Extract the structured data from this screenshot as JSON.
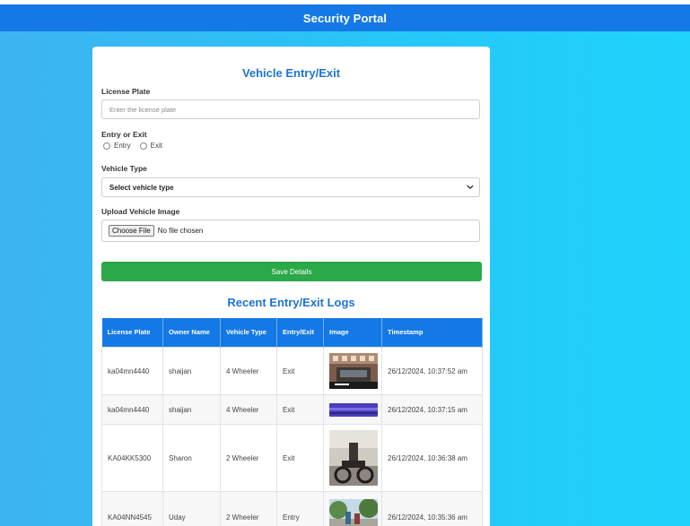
{
  "header": {
    "title": "Security Portal"
  },
  "form": {
    "title": "Vehicle Entry/Exit",
    "license_plate_label": "License Plate",
    "license_plate_placeholder": "Enter the license plate",
    "entry_exit_label": "Entry or Exit",
    "entry_option": "Entry",
    "exit_option": "Exit",
    "vehicle_type_label": "Vehicle Type",
    "vehicle_type_selected": "Select vehicle type",
    "upload_label": "Upload Vehicle Image",
    "choose_file_label": "Choose File",
    "file_status": "No file chosen",
    "save_label": "Save Details"
  },
  "logs": {
    "title": "Recent Entry/Exit Logs",
    "columns": [
      "License Plate",
      "Owner Name",
      "Vehicle Type",
      "Entry/Exit",
      "Image",
      "Timestamp"
    ],
    "rows": [
      {
        "plate": "ka04mn4440",
        "owner": "shaijan",
        "type": "4 Wheeler",
        "direction": "Exit",
        "timestamp": "26/12/2024, 10:37:52 am"
      },
      {
        "plate": "ka04mn4440",
        "owner": "shaijan",
        "type": "4 Wheeler",
        "direction": "Exit",
        "timestamp": "26/12/2024, 10:37:15 am"
      },
      {
        "plate": "KA04KK5300",
        "owner": "Sharon",
        "type": "2 Wheeler",
        "direction": "Exit",
        "timestamp": "26/12/2024, 10:36:38 am"
      },
      {
        "plate": "KA04NN4545",
        "owner": "Uday",
        "type": "2 Wheeler",
        "direction": "Entry",
        "timestamp": "26/12/2024, 10:35:36 am"
      }
    ]
  },
  "icons": {
    "select_chevron": "chevron-down-icon"
  },
  "colors": {
    "header": "#1479e6",
    "title": "#1d74d6",
    "save_button": "#2ba84a",
    "table_header": "#1479e6"
  }
}
